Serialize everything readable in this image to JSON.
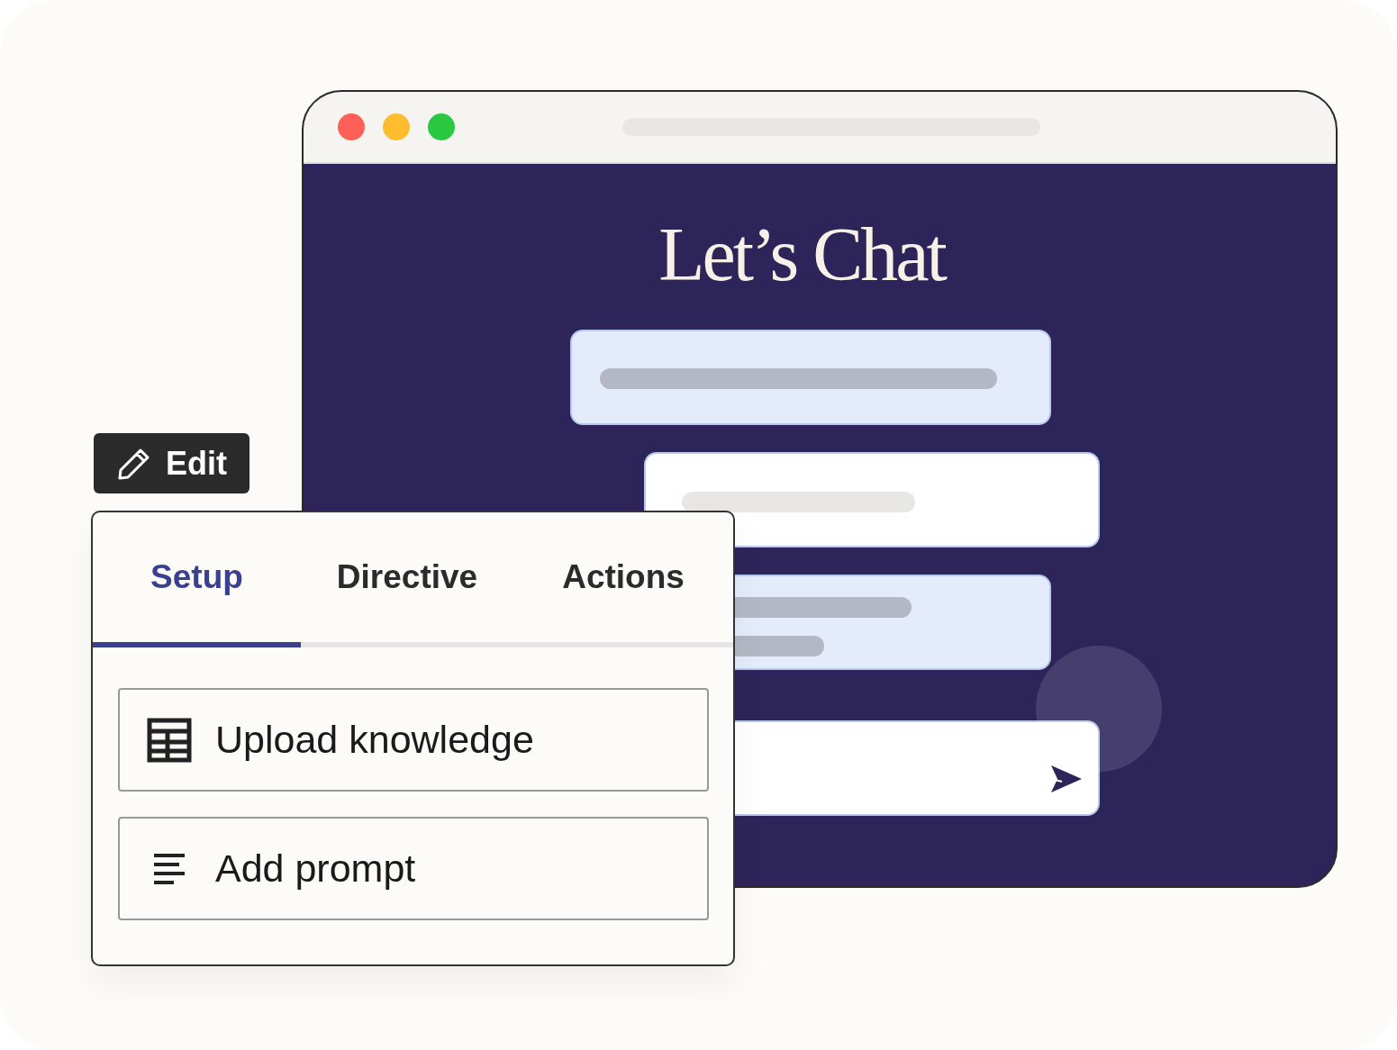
{
  "chat_window": {
    "title": "Let’s Chat",
    "messages": [
      {
        "kind": "received"
      },
      {
        "kind": "sent"
      },
      {
        "kind": "received"
      }
    ],
    "composer": {
      "kind": "input"
    }
  },
  "edit_button": {
    "label": "Edit"
  },
  "editor_panel": {
    "tabs": [
      {
        "label": "Setup",
        "selected": true
      },
      {
        "label": "Directive",
        "selected": false
      },
      {
        "label": "Actions",
        "selected": false
      }
    ],
    "actions": [
      {
        "label": "Upload knowledge",
        "kind": "table"
      },
      {
        "label": "Add prompt",
        "kind": "text"
      }
    ]
  }
}
